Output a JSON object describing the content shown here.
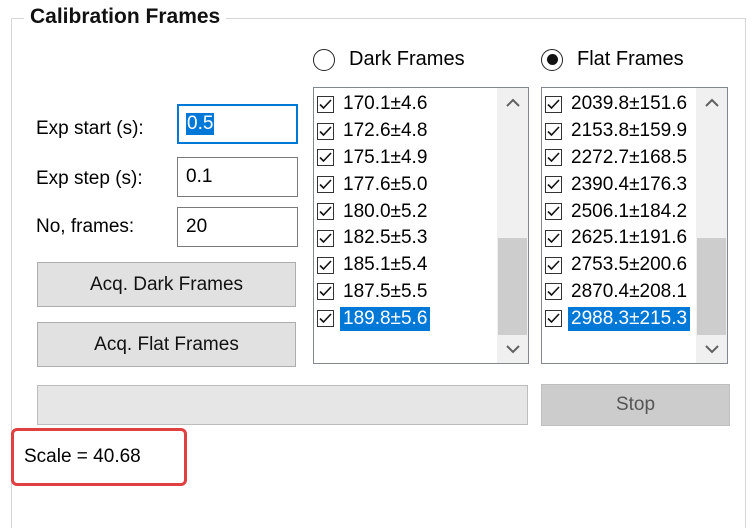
{
  "group": {
    "title": "Calibration Frames"
  },
  "frame_type": {
    "options": [
      {
        "label": "Dark Frames",
        "selected": false
      },
      {
        "label": "Flat Frames",
        "selected": true
      }
    ]
  },
  "exposure": {
    "exp_start_label": "Exp start (s):",
    "exp_start_value": "0.5",
    "exp_step_label": "Exp step (s):",
    "exp_step_value": "0.1",
    "frames_label": "No, frames:",
    "frames_value": "20"
  },
  "buttons": {
    "acq_dark": "Acq. Dark Frames",
    "acq_flat": "Acq. Flat Frames",
    "stop": "Stop"
  },
  "dark_list": {
    "items": [
      "170.1±4.6",
      "172.6±4.8",
      "175.1±4.9",
      "177.6±5.0",
      "180.0±5.2",
      "182.5±5.3",
      "185.1±5.4",
      "187.5±5.5",
      "189.8±5.6"
    ],
    "selected_index": 8
  },
  "flat_list": {
    "items": [
      "2039.8±151.6",
      "2153.8±159.9",
      "2272.7±168.5",
      "2390.4±176.3",
      "2506.1±184.2",
      "2625.1±191.6",
      "2753.5±200.6",
      "2870.4±208.1",
      "2988.3±215.3"
    ],
    "selected_index": 8
  },
  "progress": {
    "value": 0
  },
  "scale": {
    "text": "Scale = 40.68"
  },
  "colors": {
    "accent": "#0078d7",
    "highlight_box": "#e04040"
  },
  "icons": {
    "check": "check-icon",
    "up": "chevron-up-icon",
    "down": "chevron-down-icon"
  }
}
